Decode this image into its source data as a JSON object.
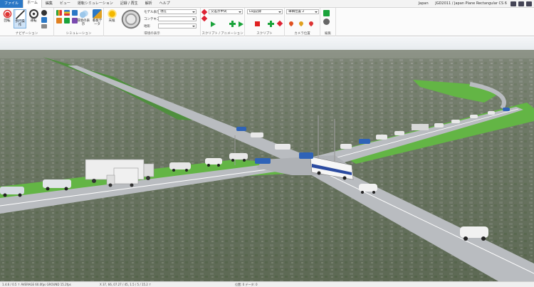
{
  "menu": {
    "file": "ファイル",
    "tabs": [
      "ホーム",
      "編集",
      "ビュー",
      "運転シミュレーション",
      "記録 / 再生",
      "解析",
      "ヘルプ"
    ],
    "active_index": 0
  },
  "header": {
    "region": "Japan",
    "crs": "JGD2011 / Japan Plane Rectangular CS 6"
  },
  "ribbon": {
    "navigation": {
      "label": "ナビゲーション",
      "rotate": "回転",
      "walk": "歩行操作",
      "drive": "運転"
    },
    "simulation": {
      "label": "シミュレーション",
      "env_display": "環境の表示",
      "scenery": "看板データ"
    },
    "environment": {
      "label": "環境の表示",
      "weather": "天候",
      "model_display_label": "モデル表示",
      "model_display_value": "現在",
      "context_label": "コンテキスト",
      "context_value": "",
      "terrain_label": "地形",
      "terrain_value": ""
    },
    "script": {
      "label": "スクリプト / アニメーション",
      "combo": "交差点中央"
    },
    "script2": {
      "label": "スクリプト",
      "combo": "Log記録"
    },
    "camera": {
      "label": "カメラ位置",
      "combo": "車輌位置 2"
    },
    "edit": {
      "label": "編集"
    }
  },
  "status": {
    "left": "1.4.6 / 0.5  ↑  AVERAGE 60.0fps   GROUND 15.2fps",
    "mid": "X 37, 66, 07.27 / 45, 1.5 / 5 / 15.2 ↑",
    "right": "位置: 0  データ: 0"
  },
  "colors": {
    "file_tab": "#2b78c6",
    "grass": "#63b545",
    "road": "#b9bcc0",
    "play": "#1aa33a",
    "stop": "#e02020"
  }
}
